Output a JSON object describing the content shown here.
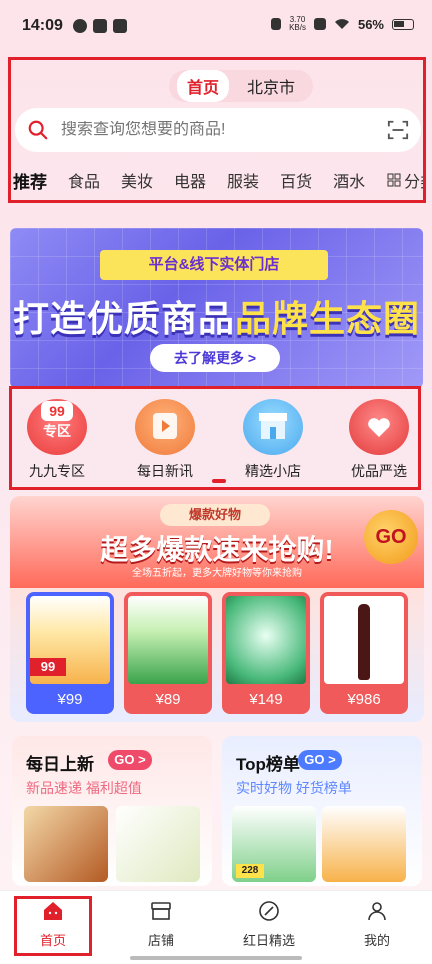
{
  "status_bar": {
    "time": "14:09",
    "net_speed_value": "3.70",
    "net_speed_unit": "KB/s",
    "battery": "56%"
  },
  "header": {
    "tabs": [
      {
        "label": "首页",
        "active": true
      },
      {
        "label": "北京市",
        "active": false
      }
    ]
  },
  "search": {
    "placeholder": "搜索查询您想要的商品!",
    "icon": "search-icon",
    "scan_icon": "scan-icon"
  },
  "categories": {
    "items": [
      "推荐",
      "食品",
      "美妆",
      "电器",
      "服装",
      "百货",
      "酒水"
    ],
    "active_index": 0,
    "more_label": "分类"
  },
  "banner": {
    "badge": "平台&线下实体门店",
    "title_part1": "打造优质商品",
    "title_part2": "品牌生态圈",
    "button": "去了解更多 >"
  },
  "quick_entries": [
    {
      "label": "九九专区",
      "icon": "zone-99-icon",
      "icon_text": "专区",
      "icon_num": "99"
    },
    {
      "label": "每日新讯",
      "icon": "news-icon"
    },
    {
      "label": "精选小店",
      "icon": "shop-icon"
    },
    {
      "label": "优品严选",
      "icon": "gift-icon"
    }
  ],
  "promo": {
    "tag": "爆款好物",
    "title": "超多爆款速来抢购!",
    "subtitle": "全场五折起，更多大牌好物等你来抢购",
    "go": "GO",
    "products": [
      {
        "price": "¥99",
        "label": "99"
      },
      {
        "price": "¥89"
      },
      {
        "price": "¥149"
      },
      {
        "price": "¥986"
      }
    ]
  },
  "cards": {
    "left": {
      "title": "每日上新",
      "go": "GO >",
      "subtitle": "新品速递 福利超值"
    },
    "right": {
      "title": "Top榜单",
      "go": "GO >",
      "subtitle": "实时好物 好货榜单",
      "price_tag": "228"
    }
  },
  "tabbar": [
    {
      "label": "首页",
      "icon": "home-icon",
      "active": true
    },
    {
      "label": "店铺",
      "icon": "store-icon",
      "active": false
    },
    {
      "label": "红日精选",
      "icon": "selection-icon",
      "active": false
    },
    {
      "label": "我的",
      "icon": "profile-icon",
      "active": false
    }
  ],
  "colors": {
    "accent": "#e0202a",
    "banner": "#6a62e8",
    "go_left": "#f04a6a",
    "go_right": "#4d7bff"
  }
}
